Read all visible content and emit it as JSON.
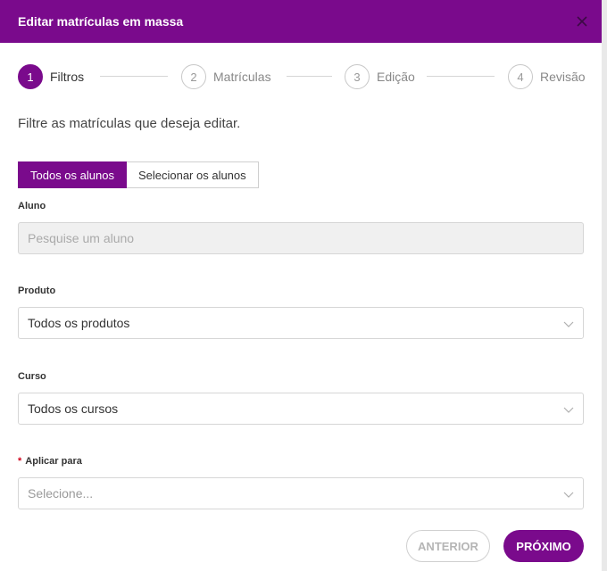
{
  "header": {
    "title": "Editar matrículas em massa"
  },
  "steps": [
    {
      "number": "1",
      "label": "Filtros"
    },
    {
      "number": "2",
      "label": "Matrículas"
    },
    {
      "number": "3",
      "label": "Edição"
    },
    {
      "number": "4",
      "label": "Revisão"
    }
  ],
  "intro": "Filtre as matrículas que deseja editar.",
  "toggle": {
    "all_students": "Todos os alunos",
    "select_students": "Selecionar os alunos"
  },
  "fields": {
    "student": {
      "label": "Aluno",
      "placeholder": "Pesquise um aluno"
    },
    "product": {
      "label": "Produto",
      "value": "Todos os produtos"
    },
    "course": {
      "label": "Curso",
      "value": "Todos os cursos"
    },
    "apply_to": {
      "label": "Aplicar para",
      "placeholder": "Selecione...",
      "required_mark": "*"
    }
  },
  "buttons": {
    "previous": "ANTERIOR",
    "next": "PRÓXIMO"
  },
  "colors": {
    "primary": "#7a0a8c",
    "required": "#d0021b"
  }
}
